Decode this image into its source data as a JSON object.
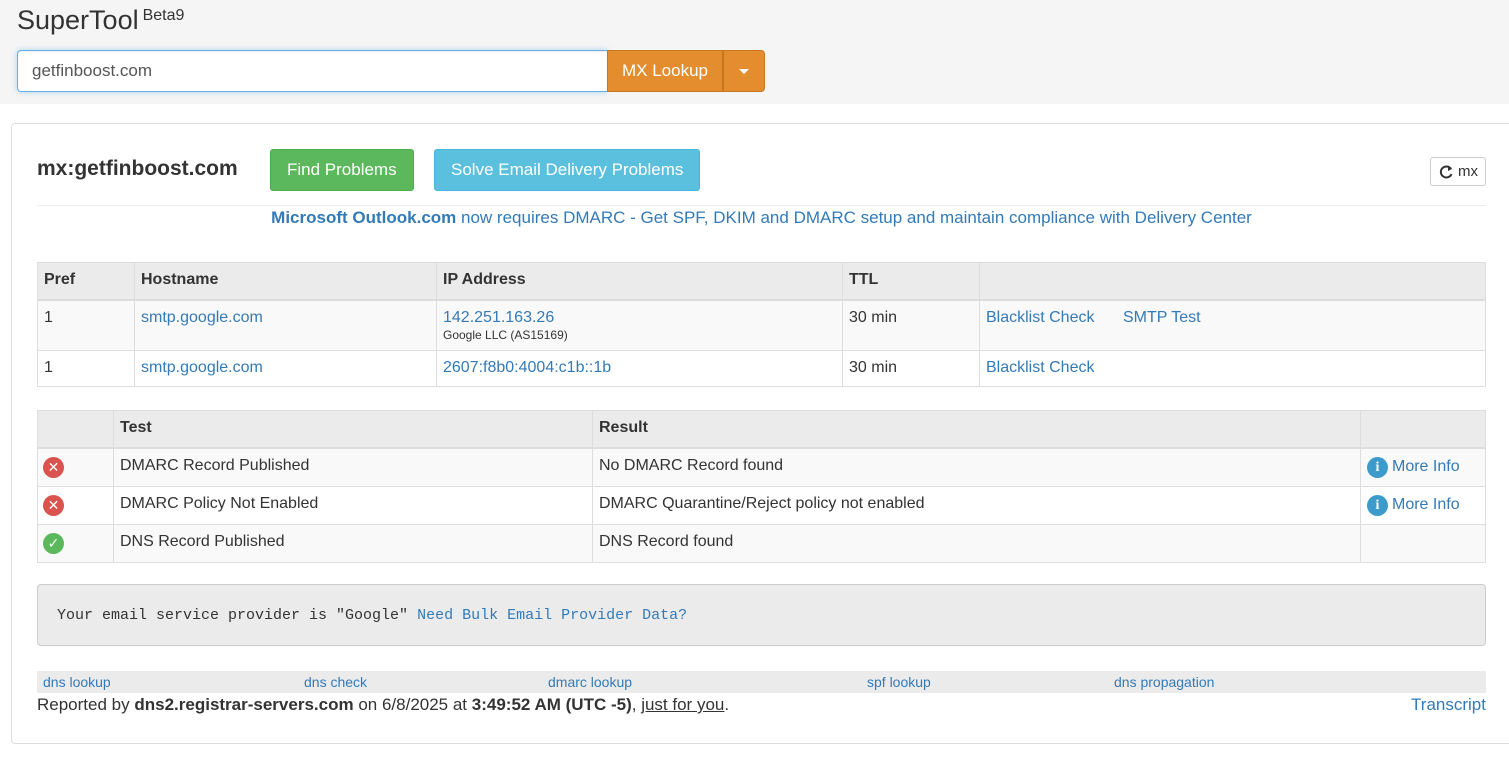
{
  "app": {
    "name": "SuperTool",
    "beta": "Beta9"
  },
  "search": {
    "value": "getfinboost.com",
    "button_label": "MX Lookup"
  },
  "result": {
    "title": "mx:getfinboost.com",
    "find_problems": "Find Problems",
    "solve": "Solve Email Delivery Problems",
    "refresh": "mx"
  },
  "notice": {
    "bold": "Microsoft Outlook.com",
    "rest": " now requires DMARC - Get SPF, DKIM and DMARC setup and maintain compliance with Delivery Center"
  },
  "mx_table": {
    "headers": [
      "Pref",
      "Hostname",
      "IP Address",
      "TTL",
      ""
    ],
    "rows": [
      {
        "pref": "1",
        "hostname": "smtp.google.com",
        "ip": "142.251.163.26",
        "ip_sub": "Google LLC (AS15169)",
        "ttl": "30 min",
        "link1": "Blacklist Check",
        "link2": "SMTP Test"
      },
      {
        "pref": "1",
        "hostname": "smtp.google.com",
        "ip": "2607:f8b0:4004:c1b::1b",
        "ip_sub": "",
        "ttl": "30 min",
        "link1": "Blacklist Check",
        "link2": ""
      }
    ]
  },
  "test_table": {
    "headers": [
      "",
      "Test",
      "Result",
      ""
    ],
    "rows": [
      {
        "status": "error",
        "test": "DMARC Record Published",
        "result": "No DMARC Record found",
        "more": "More Info"
      },
      {
        "status": "error",
        "test": "DMARC Policy Not Enabled",
        "result": "DMARC Quarantine/Reject policy not enabled",
        "more": "More Info"
      },
      {
        "status": "ok",
        "test": "DNS Record Published",
        "result": "DNS Record found",
        "more": ""
      }
    ]
  },
  "provider": {
    "text": "Your email service provider is \"Google\"",
    "link": "Need Bulk Email Provider Data?"
  },
  "footer_links": [
    "dns lookup",
    "dns check",
    "dmarc lookup",
    "spf lookup",
    "dns propagation"
  ],
  "reported": {
    "prefix": "Reported by",
    "server": "dns2.registrar-servers.com",
    "on": "on 6/8/2025 at",
    "time": "3:49:52 AM (UTC -5)",
    "comma": ",",
    "just": "just for you",
    "period": ".",
    "transcript": "Transcript"
  },
  "colors": {
    "orange": "#e38d2f",
    "green": "#5cb85c",
    "info": "#5bc0de",
    "link": "#337ab7",
    "error": "#d9534f"
  }
}
